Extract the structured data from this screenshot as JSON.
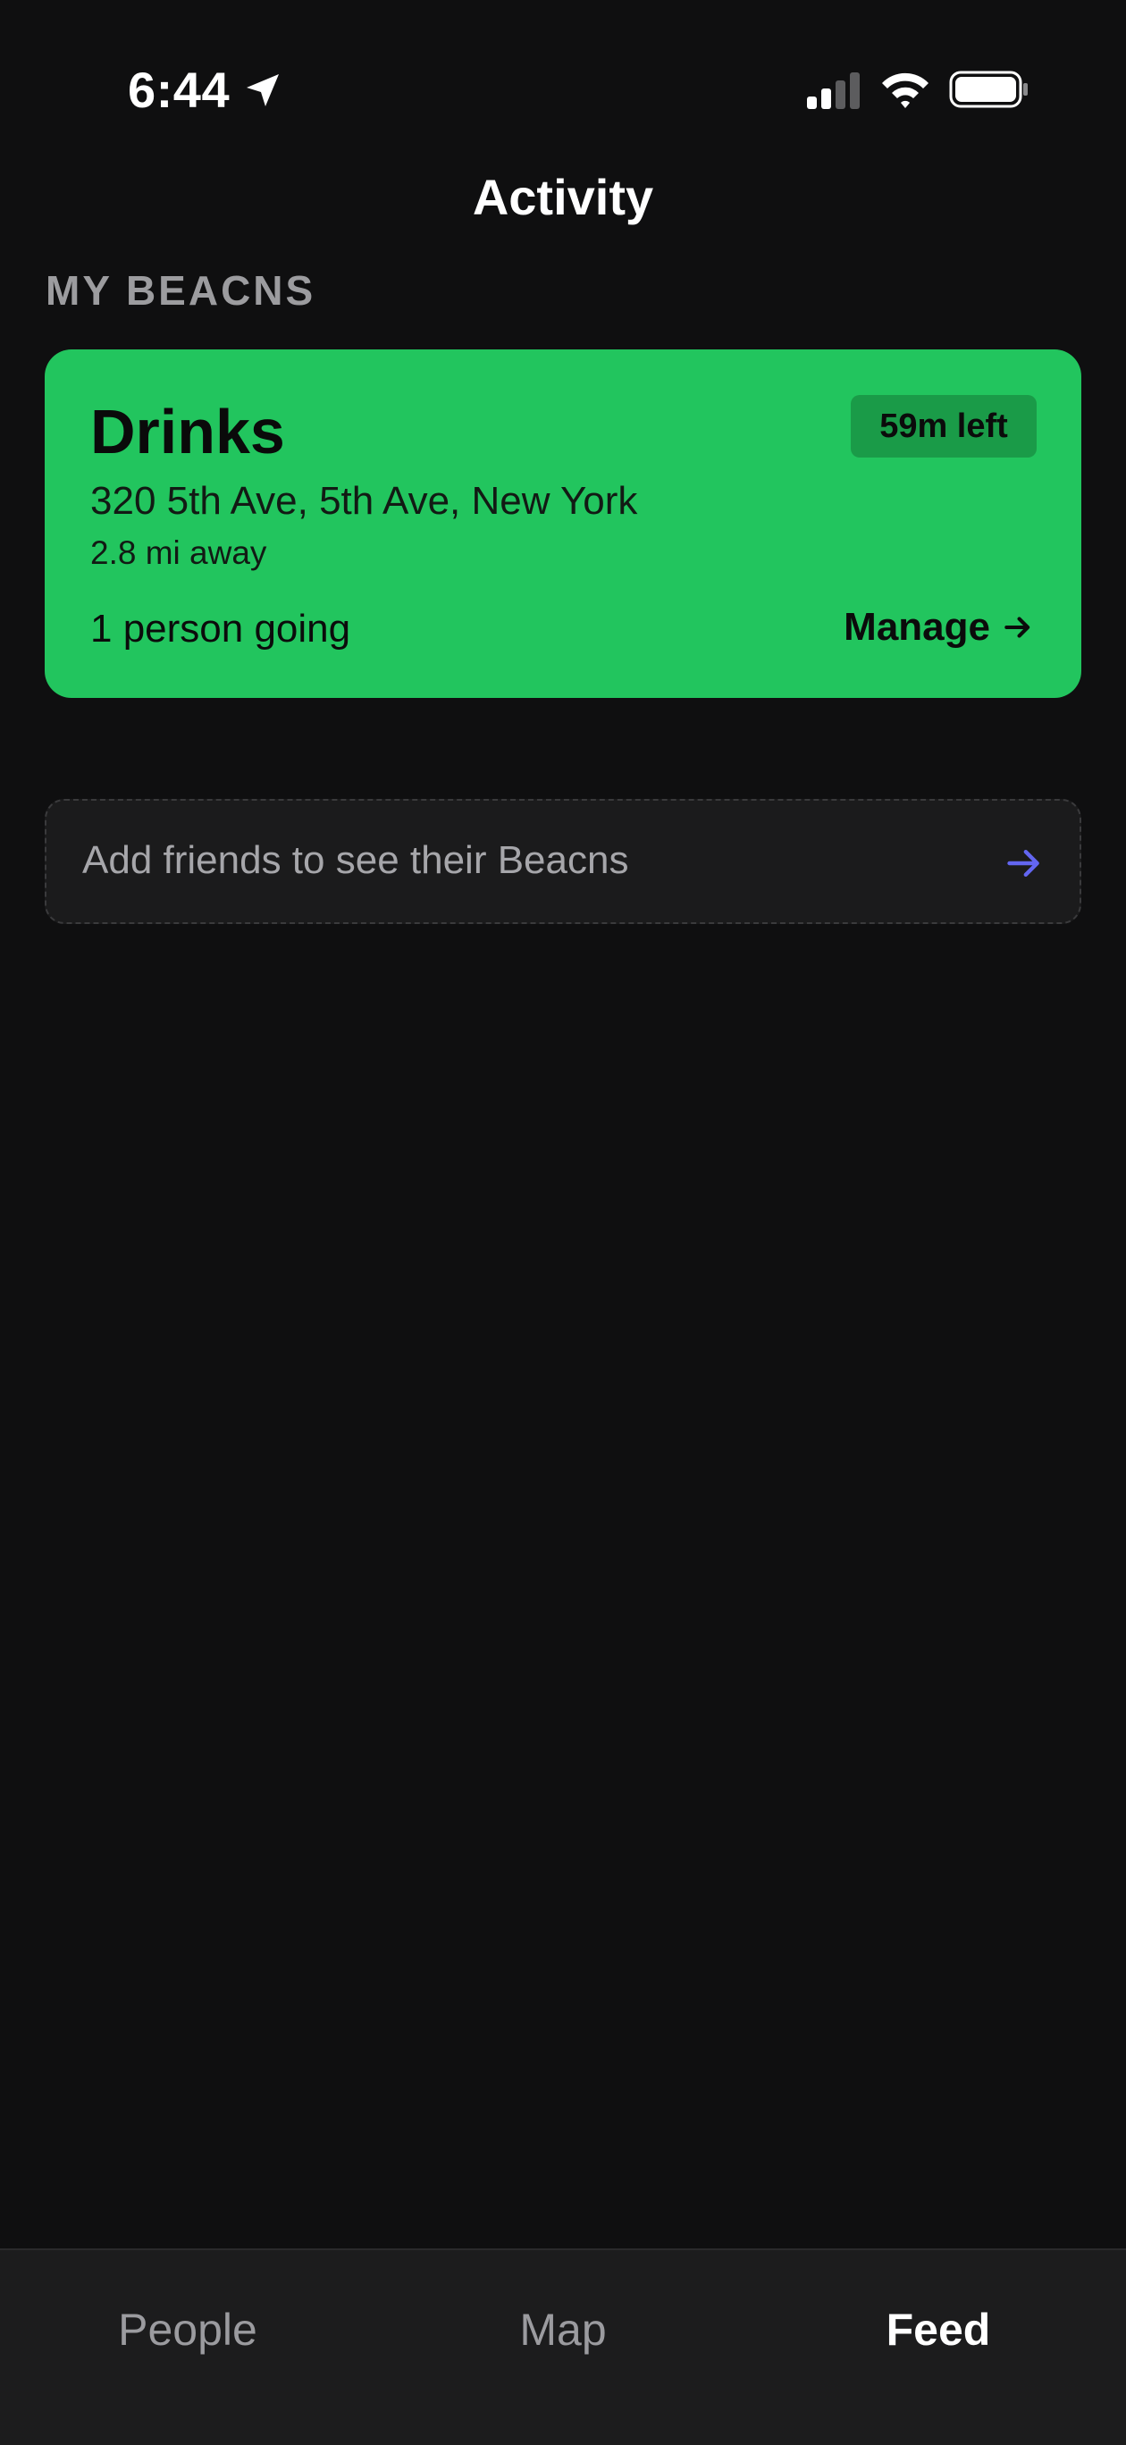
{
  "status_bar": {
    "time": "6:44",
    "icons": [
      "location-arrow-icon",
      "cellular-signal-icon",
      "wifi-icon",
      "battery-icon"
    ]
  },
  "header": {
    "title": "Activity"
  },
  "my_beacons": {
    "section_label": "MY BEACNS",
    "card": {
      "title": "Drinks",
      "time_left": "59m left",
      "address": "320 5th Ave, 5th Ave, New York",
      "distance": "2.8 mi away",
      "going": "1 person going",
      "manage_label": "Manage",
      "color": "#22c55e"
    }
  },
  "add_friends": {
    "text": "Add friends to see their Beacns",
    "arrow_icon": "arrow-right-icon",
    "arrow_color": "#6366f1"
  },
  "tab_bar": {
    "tabs": [
      {
        "label": "People",
        "active": false
      },
      {
        "label": "Map",
        "active": false
      },
      {
        "label": "Feed",
        "active": true
      }
    ]
  }
}
